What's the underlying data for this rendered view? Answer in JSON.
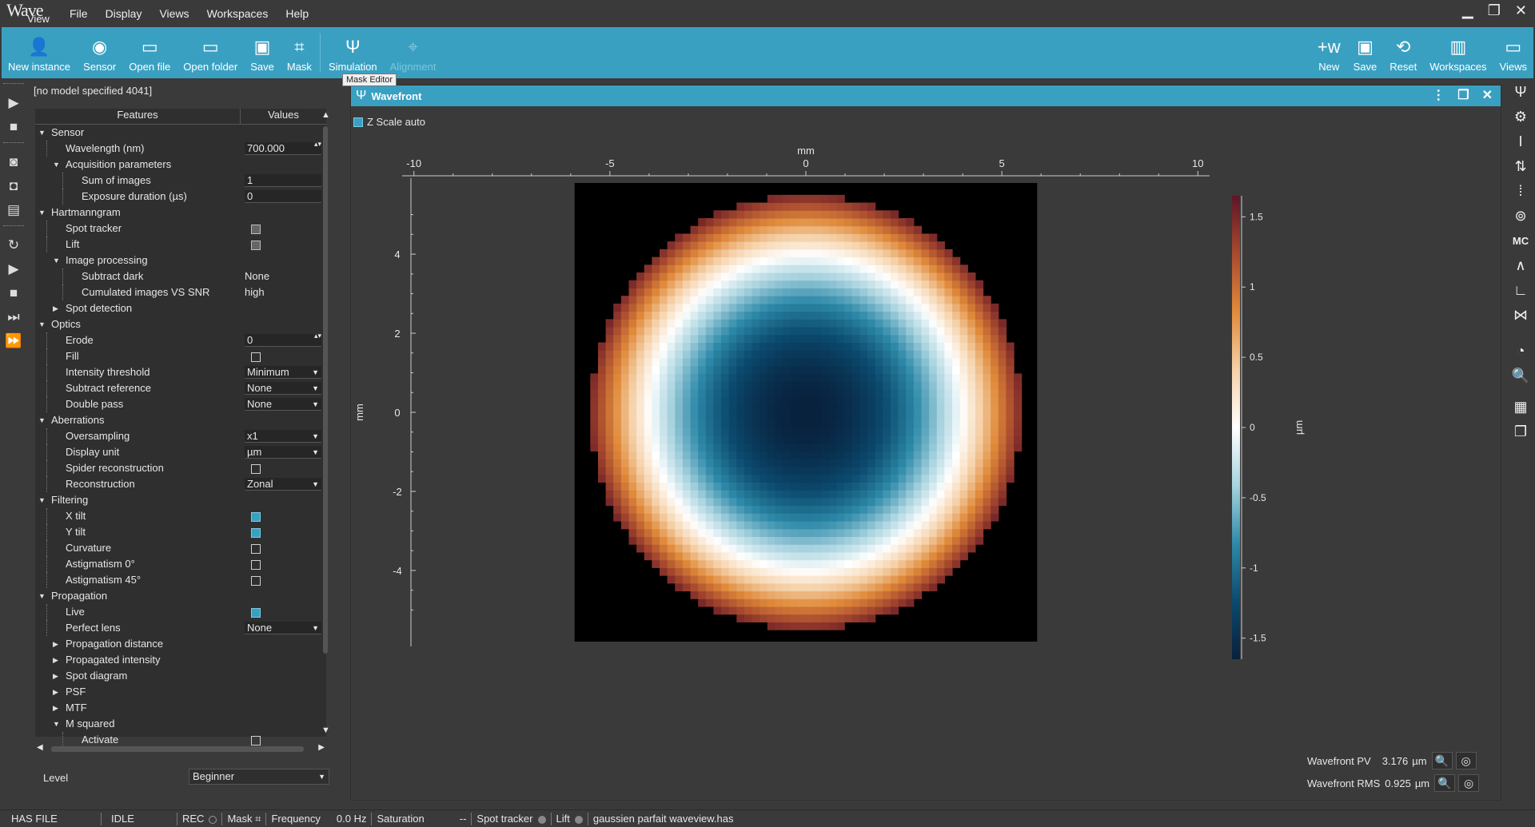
{
  "app": {
    "logo_top": "Wave",
    "logo_bottom": "View"
  },
  "menu": [
    "File",
    "Display",
    "Views",
    "Workspaces",
    "Help"
  ],
  "toolbar": {
    "left": [
      {
        "label": "New instance",
        "icon": "new-instance-icon"
      },
      {
        "label": "Sensor",
        "icon": "sensor-icon"
      },
      {
        "label": "Open file",
        "icon": "open-file-icon"
      },
      {
        "label": "Open folder",
        "icon": "open-folder-icon"
      },
      {
        "label": "Save",
        "icon": "save-icon"
      },
      {
        "label": "Mask",
        "icon": "mask-icon"
      },
      {
        "label": "Simulation",
        "icon": "simulation-icon"
      },
      {
        "label": "Alignment",
        "icon": "alignment-icon",
        "disabled": true
      }
    ],
    "right": [
      {
        "label": "New",
        "icon": "new-workspace-icon"
      },
      {
        "label": "Save",
        "icon": "save-workspace-icon"
      },
      {
        "label": "Reset",
        "icon": "reset-icon"
      },
      {
        "label": "Workspaces",
        "icon": "workspaces-icon"
      },
      {
        "label": "Views",
        "icon": "views-icon"
      }
    ],
    "tooltip": "Mask Editor"
  },
  "panel": {
    "model_title": "[no model specified 4041]",
    "col_features": "Features",
    "col_values": "Values",
    "level_label": "Level",
    "level_value": "Beginner"
  },
  "tree": [
    {
      "d": 0,
      "label": "Sensor",
      "exp": "open"
    },
    {
      "d": 1,
      "label": "Wavelength (nm)",
      "type": "spin",
      "value": "700.000"
    },
    {
      "d": 1,
      "label": "Acquisition parameters",
      "exp": "open"
    },
    {
      "d": 2,
      "label": "Sum of images",
      "type": "box",
      "value": "1"
    },
    {
      "d": 2,
      "label": "Exposure duration (µs)",
      "type": "box",
      "value": "0"
    },
    {
      "d": 0,
      "label": "Hartmanngram",
      "exp": "open"
    },
    {
      "d": 1,
      "label": "Spot tracker",
      "type": "cb",
      "state": "grey"
    },
    {
      "d": 1,
      "label": "Lift",
      "type": "cb",
      "state": "grey"
    },
    {
      "d": 1,
      "label": "Image processing",
      "exp": "open"
    },
    {
      "d": 2,
      "label": "Subtract dark",
      "type": "text",
      "value": "None"
    },
    {
      "d": 2,
      "label": "Cumulated images VS SNR",
      "type": "text",
      "value": "high"
    },
    {
      "d": 1,
      "label": "Spot detection",
      "exp": "closed"
    },
    {
      "d": 0,
      "label": "Optics",
      "exp": "open"
    },
    {
      "d": 1,
      "label": "Erode",
      "type": "spin",
      "value": "0"
    },
    {
      "d": 1,
      "label": "Fill",
      "type": "cb",
      "state": "off"
    },
    {
      "d": 1,
      "label": "Intensity threshold",
      "type": "dd",
      "value": "Minimum"
    },
    {
      "d": 1,
      "label": "Subtract reference",
      "type": "dd",
      "value": "None"
    },
    {
      "d": 1,
      "label": "Double pass",
      "type": "dd",
      "value": "None"
    },
    {
      "d": 0,
      "label": "Aberrations",
      "exp": "open"
    },
    {
      "d": 1,
      "label": "Oversampling",
      "type": "dd",
      "value": "x1"
    },
    {
      "d": 1,
      "label": "Display unit",
      "type": "dd",
      "value": "µm"
    },
    {
      "d": 1,
      "label": "Spider reconstruction",
      "type": "cb",
      "state": "off"
    },
    {
      "d": 1,
      "label": "Reconstruction",
      "type": "dd",
      "value": "Zonal"
    },
    {
      "d": 0,
      "label": "Filtering",
      "exp": "open"
    },
    {
      "d": 1,
      "label": "X tilt",
      "type": "cb",
      "state": "on"
    },
    {
      "d": 1,
      "label": "Y tilt",
      "type": "cb",
      "state": "on"
    },
    {
      "d": 1,
      "label": "Curvature",
      "type": "cb",
      "state": "off"
    },
    {
      "d": 1,
      "label": "Astigmatism 0°",
      "type": "cb",
      "state": "off"
    },
    {
      "d": 1,
      "label": "Astigmatism 45°",
      "type": "cb",
      "state": "off"
    },
    {
      "d": 0,
      "label": "Propagation",
      "exp": "open"
    },
    {
      "d": 1,
      "label": "Live",
      "type": "cb",
      "state": "on"
    },
    {
      "d": 1,
      "label": "Perfect lens",
      "type": "dd",
      "value": "None"
    },
    {
      "d": 1,
      "label": "Propagation distance",
      "exp": "closed"
    },
    {
      "d": 1,
      "label": "Propagated intensity",
      "exp": "closed"
    },
    {
      "d": 1,
      "label": "Spot diagram",
      "exp": "closed"
    },
    {
      "d": 1,
      "label": "PSF",
      "exp": "closed"
    },
    {
      "d": 1,
      "label": "MTF",
      "exp": "closed"
    },
    {
      "d": 1,
      "label": "M squared",
      "exp": "open"
    },
    {
      "d": 2,
      "label": "Activate",
      "type": "cb",
      "state": "off"
    }
  ],
  "wavefront": {
    "title": "Wavefront",
    "zscale_label": "Z Scale auto",
    "pv_label": "Wavefront PV",
    "pv_value": "3.176",
    "pv_unit": "µm",
    "rms_label": "Wavefront RMS",
    "rms_value": "0.925",
    "rms_unit": "µm"
  },
  "chart_data": {
    "type": "heatmap",
    "x_label": "mm",
    "y_label": "mm",
    "colorbar_label": "µm",
    "x_ticks": [
      -10,
      -5,
      0,
      5,
      10
    ],
    "y_ticks": [
      4,
      2,
      0,
      -2,
      -4
    ],
    "colorbar_ticks": [
      1.5,
      1,
      0.5,
      0,
      -0.5,
      -1,
      -1.5
    ],
    "x_range": [
      -10.3,
      10.3
    ],
    "y_range": [
      -5.8,
      5.8
    ],
    "data_x_range": [
      -5.9,
      5.9
    ],
    "data_y_range": [
      -5.8,
      5.8
    ],
    "pupil_radius_mm": 5.5,
    "z_range": [
      -1.65,
      1.65
    ],
    "z_center": -1.65,
    "z_edge": 1.5,
    "colormap": [
      "#08213d",
      "#0b4a6e",
      "#2e8aa9",
      "#a8d3df",
      "#ffffff",
      "#f5d1a8",
      "#e08a3a",
      "#a84a2e",
      "#5e1526"
    ],
    "background": "#000000"
  },
  "status": {
    "has_file": "HAS FILE",
    "state": "IDLE",
    "rec": "REC",
    "mask": "Mask",
    "frequency_label": "Frequency",
    "frequency_value": "0.0 Hz",
    "saturation_label": "Saturation",
    "saturation_value": "--",
    "spot_tracker": "Spot tracker",
    "lift": "Lift",
    "filename": "gaussien parfait waveview.has"
  }
}
